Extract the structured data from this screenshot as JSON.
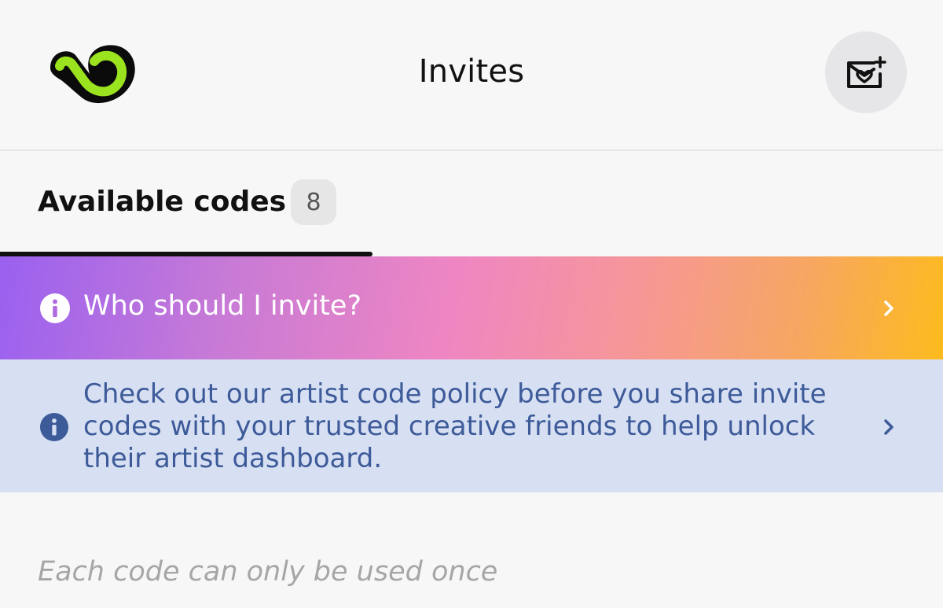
{
  "header": {
    "title": "Invites",
    "logo_icon": "audius-like-logo-icon",
    "action_icon": "envelope-heart-plus-icon"
  },
  "tabs": [
    {
      "label": "Available codes",
      "count": "8",
      "active": true
    }
  ],
  "banner": {
    "text": "Who should I invite?",
    "icon": "info-icon",
    "chevron": "chevron-right-icon"
  },
  "policy": {
    "text": "Check out our artist code policy before you share invite codes with your trusted creative friends to help unlock their artist dashboard.",
    "icon": "info-icon",
    "chevron": "chevron-right-icon"
  },
  "note": "Each code can only be used once",
  "colors": {
    "accent_green": "#9be21f",
    "policy_text": "#3d5a99",
    "policy_bg": "#d7e0f3"
  }
}
